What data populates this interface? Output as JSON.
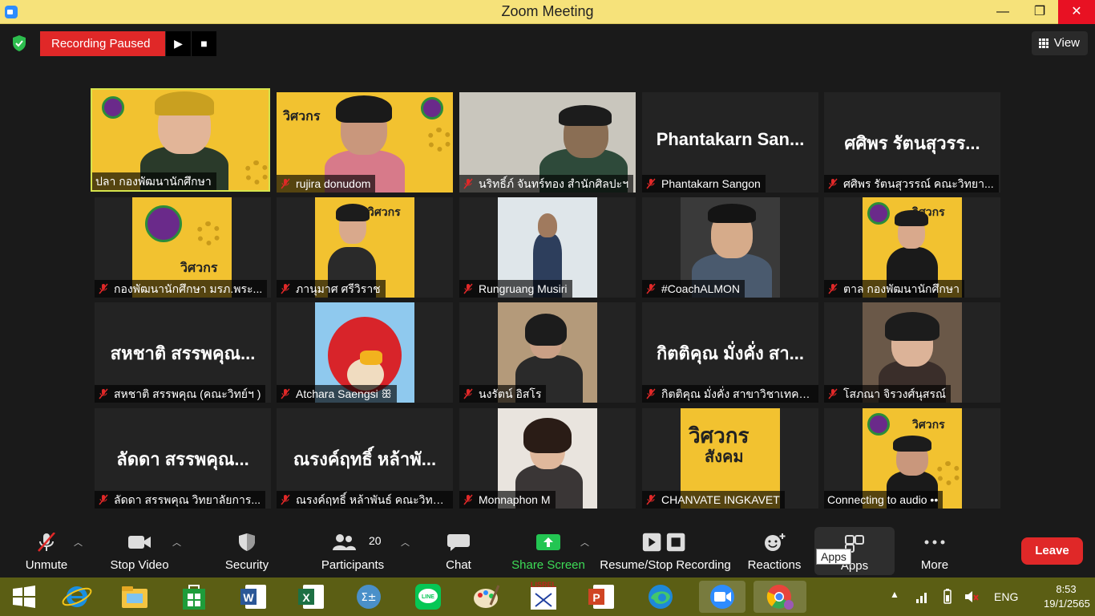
{
  "window": {
    "title": "Zoom Meeting",
    "min": "—",
    "max": "❐",
    "close": "✕"
  },
  "recording": {
    "status": "Recording Paused",
    "resume": "▶",
    "stop": "■"
  },
  "view": {
    "label": "View"
  },
  "tiles": [
    {
      "name": "ปลา กองพัฒนานักศึกษา",
      "muted": false
    },
    {
      "name": "rujira donudom",
      "muted": true
    },
    {
      "name": "นริทธิ์ภ์ จันทร์ทอง สำนักศิลปะฯ",
      "muted": true
    },
    {
      "name": "Phantakarn Sangon",
      "big": "Phantakarn San...",
      "muted": true
    },
    {
      "name": "ศศิพร รัตนสุวรรณ์ คณะวิทยา...",
      "big": "ศศิพร รัตนสุวรร...",
      "muted": true
    },
    {
      "name": "กองพัฒนานักศึกษา มรภ.พระ...",
      "muted": true
    },
    {
      "name": "ภานุมาศ ศรีวิราช",
      "muted": true
    },
    {
      "name": "Rungruang Musiri",
      "muted": true
    },
    {
      "name": "#CoachALMON",
      "muted": true
    },
    {
      "name": "ตาล กองพัฒนานักศึกษา",
      "muted": true
    },
    {
      "name": "สหชาติ สรรพคุณ (คณะวิทย์ฯ )",
      "big": "สหชาติ สรรพคุณ...",
      "muted": true
    },
    {
      "name": "Atchara Saengsi ꕥ",
      "muted": true
    },
    {
      "name": "นงรัตน์ อิสโร",
      "muted": true
    },
    {
      "name": "กิตติคุณ  มั่งคั่ง สาขาวิชาเทคโ...",
      "big": "กิตติคุณ  มั่งคั่ง สา...",
      "muted": true
    },
    {
      "name": "โสภณา จิรวงศ์นุสรณ์",
      "muted": true
    },
    {
      "name": "ลัดดา สรรพคุณ  วิทยาลัยการ...",
      "big": "ลัดดา สรรพคุณ...",
      "muted": true
    },
    {
      "name": "ณรงค์ฤทธิ์ หล้าพันธ์ คณะวิทย...",
      "big": "ณรงค์ฤทธิ์ หล้าพั...",
      "muted": true
    },
    {
      "name": "Monnaphon M",
      "muted": true
    },
    {
      "name": "CHANVATE INGKAVET",
      "muted": true
    },
    {
      "name": "Connecting to audio ••",
      "muted": false
    }
  ],
  "poster": {
    "brand": "วิศวกร",
    "brand2": "สังคม"
  },
  "toolbar": {
    "unmute": "Unmute",
    "stop_video": "Stop Video",
    "security": "Security",
    "participants": "Participants",
    "participants_count": "20",
    "chat": "Chat",
    "share_screen": "Share Screen",
    "recording": "Resume/Stop Recording",
    "reactions": "Reactions",
    "apps": "Apps",
    "more": "More",
    "leave": "Leave",
    "tooltip": "Apps"
  },
  "taskbar": {
    "lang": "ENG",
    "time": "8:53",
    "date": "19/1/2565"
  },
  "colors": {
    "accent": "#2d8cff",
    "record": "#e02828",
    "share": "#3ddc57",
    "titlebar": "#f6e27a",
    "taskbar": "#5b5e14"
  }
}
